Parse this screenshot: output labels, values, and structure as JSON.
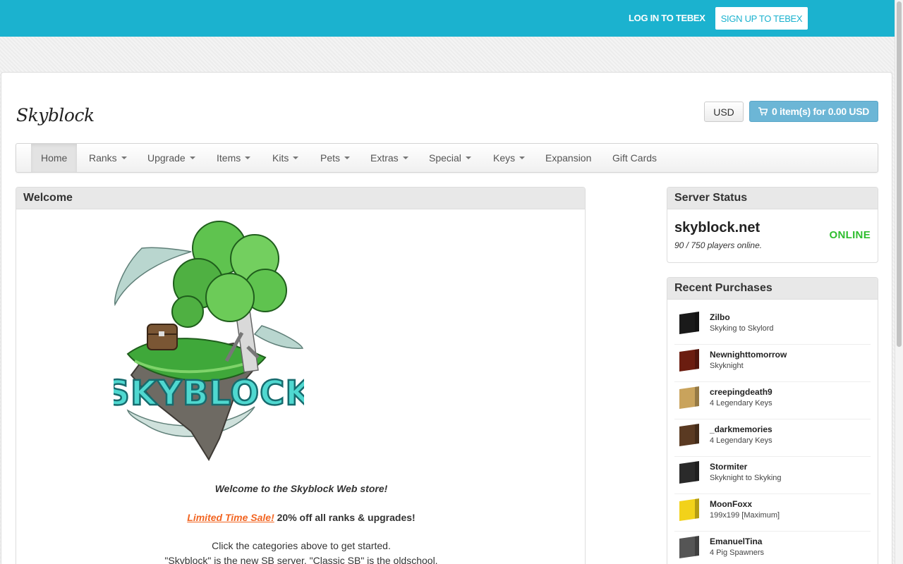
{
  "topbar": {
    "login_label": "LOG IN TO TEBEX",
    "signup_label": "SIGN UP TO TEBEX",
    "accent_color": "#1bb2cf"
  },
  "header": {
    "logo_text": "Skyblock",
    "currency_label": "USD",
    "cart_label": "0 item(s) for 0.00 USD",
    "cart_icon": "cart-icon"
  },
  "nav": {
    "items": [
      {
        "label": "Home",
        "dropdown": false,
        "active": true
      },
      {
        "label": "Ranks",
        "dropdown": true
      },
      {
        "label": "Upgrade",
        "dropdown": true
      },
      {
        "label": "Items",
        "dropdown": true
      },
      {
        "label": "Kits",
        "dropdown": true
      },
      {
        "label": "Pets",
        "dropdown": true
      },
      {
        "label": "Extras",
        "dropdown": true
      },
      {
        "label": "Special",
        "dropdown": true
      },
      {
        "label": "Keys",
        "dropdown": true
      },
      {
        "label": "Expansion",
        "dropdown": false
      },
      {
        "label": "Gift Cards",
        "dropdown": false
      }
    ]
  },
  "welcome": {
    "title": "Welcome",
    "hero_text": "SKYBLOCK",
    "intro": "Welcome to the Skyblock Web store!",
    "sale_link": "Limited Time Sale!",
    "sale_text": " 20% off all ranks & upgrades!",
    "paragraph1": "Click the categories above to get started.",
    "paragraph2": "\"Skyblock\" is the new SB server. \"Classic SB\" is the oldschool."
  },
  "server_status": {
    "title": "Server Status",
    "host": "skyblock.net",
    "players": "90 / 750 players online.",
    "state": "ONLINE",
    "state_color": "#2ebd2e"
  },
  "recent_purchases": {
    "title": "Recent Purchases",
    "items": [
      {
        "name": "Zilbo",
        "item": "Skyking to Skylord",
        "avatar_color": "#1a1a1a"
      },
      {
        "name": "Newnighttomorrow",
        "item": "Skyknight",
        "avatar_color": "#6b1d10"
      },
      {
        "name": "creepingdeath9",
        "item": "4 Legendary Keys",
        "avatar_color": "#c9a35c"
      },
      {
        "name": "_darkmemories",
        "item": "4 Legendary Keys",
        "avatar_color": "#5a3a22"
      },
      {
        "name": "Stormiter",
        "item": "Skyknight to Skyking",
        "avatar_color": "#2a2a2a"
      },
      {
        "name": "MoonFoxx",
        "item": "199x199 [Maximum]",
        "avatar_color": "#f2d21a"
      },
      {
        "name": "EmanuelTina",
        "item": "4 Pig Spawners",
        "avatar_color": "#555555"
      }
    ]
  }
}
